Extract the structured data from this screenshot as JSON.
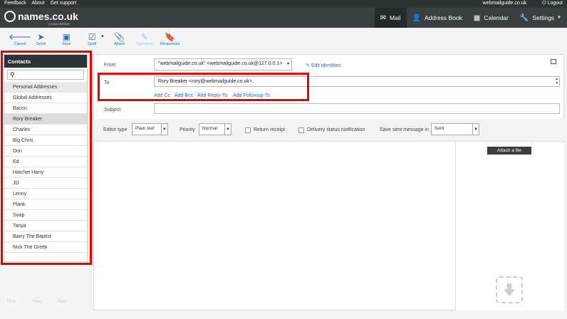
{
  "topbar": {
    "links": [
      "Feedback",
      "About",
      "Get support"
    ],
    "domain": "webmailguide.co.uk",
    "logout": "Logout"
  },
  "brand": {
    "name": "names.co.uk",
    "tagline": "A DADA BRAND"
  },
  "nav": [
    {
      "label": "Mail",
      "icon": "mail-icon"
    },
    {
      "label": "Address Book",
      "icon": "person-icon"
    },
    {
      "label": "Calendar",
      "icon": "calendar-icon"
    },
    {
      "label": "Settings",
      "icon": "wrench-icon"
    }
  ],
  "toolbar": {
    "cancel": "Cancel",
    "send": "Send",
    "save": "Save",
    "spell": "Spell",
    "attach": "Attach",
    "signature": "Signature",
    "responses": "Responses"
  },
  "contacts": {
    "title": "Contacts",
    "groups": [
      "Personal Addresses",
      "Global Addresses"
    ],
    "items": [
      "Bacon",
      "Rory Breaker",
      "Charles",
      "Big Chris",
      "Don",
      "Ed",
      "Hatchet Harry",
      "JD",
      "Lenny",
      "Plank",
      "Soap",
      "Tanya",
      "Barry The Baptist",
      "Nick The Greek"
    ],
    "pager": [
      "First",
      "Prev",
      "Next"
    ]
  },
  "compose": {
    "from_label": "From",
    "from_value": "\"webmailguide.co.uk\" <webmailguide.co.uk@127.0.0.1>",
    "edit_identities": "Edit identities",
    "to_label": "To",
    "to_value": "Rory Breaker <rory@webmailguide.co.uk>,",
    "add_links": [
      "Add Cc",
      "Add Bcc",
      "Add Reply-To",
      "Add Followup-To"
    ],
    "subject_label": "Subject",
    "subject_value": ""
  },
  "options": {
    "editor_type_label": "Editor type",
    "editor_type": "Plain text",
    "priority_label": "Priority",
    "priority": "Normal",
    "return_receipt": "Return receipt",
    "delivery_status": "Delivery status notification",
    "save_sent_label": "Save sent message in",
    "save_sent": "Sent"
  },
  "attach_button": "Attach a file"
}
